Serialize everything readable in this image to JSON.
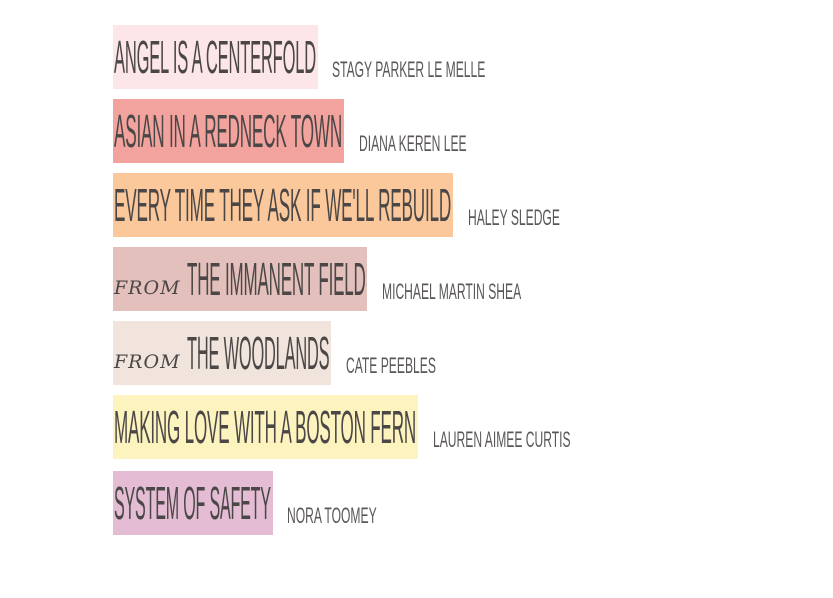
{
  "entries": [
    {
      "prefix": "",
      "title": "ANGEL IS A CENTERFOLD",
      "author": "STAGY PARKER LE MELLE",
      "color": "#fde6e8"
    },
    {
      "prefix": "",
      "title": "ASIAN IN A REDNECK TOWN",
      "author": "DIANA KEREN LEE",
      "color": "#f3a39e"
    },
    {
      "prefix": "",
      "title": "EVERY TIME THEY ASK IF WE'LL REBUILD",
      "author": "HALEY SLEDGE",
      "color": "#fbc89c"
    },
    {
      "prefix": "FROM",
      "title": "THE IMMANENT FIELD",
      "author": "MICHAEL MARTIN SHEA",
      "color": "#e3c0bb"
    },
    {
      "prefix": "FROM",
      "title": "THE WOODLANDS",
      "author": "CATE PEEBLES",
      "color": "#f0e4dc"
    },
    {
      "prefix": "",
      "title": "MAKING LOVE WITH A BOSTON FERN",
      "author": "LAUREN AIMEE CURTIS",
      "color": "#fcf3bf"
    },
    {
      "prefix": "",
      "title": "SYSTEM OF SAFETY",
      "author": "NORA TOOMEY",
      "color": "#e4bdd4"
    }
  ]
}
